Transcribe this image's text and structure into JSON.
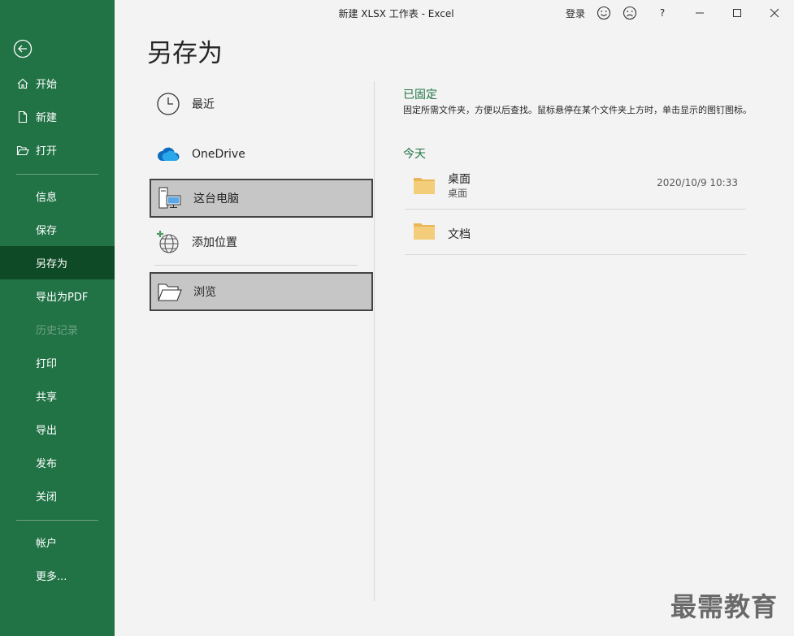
{
  "window": {
    "title": "新建 XLSX 工作表  -  Excel",
    "signin_label": "登录",
    "help_label": "?"
  },
  "sidebar": {
    "items": [
      {
        "label": "开始",
        "icon": "home-icon"
      },
      {
        "label": "新建",
        "icon": "new-document-icon"
      },
      {
        "label": "打开",
        "icon": "open-folder-icon"
      },
      {
        "label": "信息"
      },
      {
        "label": "保存"
      },
      {
        "label": "另存为",
        "active": true
      },
      {
        "label": "导出为PDF"
      },
      {
        "label": "历史记录",
        "disabled": true
      },
      {
        "label": "打印"
      },
      {
        "label": "共享"
      },
      {
        "label": "导出"
      },
      {
        "label": "发布"
      },
      {
        "label": "关闭"
      },
      {
        "label": "帐户"
      },
      {
        "label": "更多..."
      }
    ]
  },
  "page": {
    "title": "另存为"
  },
  "locations": [
    {
      "label": "最近",
      "icon": "clock-icon"
    },
    {
      "label": "OneDrive",
      "icon": "onedrive-cloud-icon"
    },
    {
      "label": "这台电脑",
      "icon": "computer-icon",
      "selected": true
    },
    {
      "label": "添加位置",
      "icon": "add-location-globe-icon"
    },
    {
      "label": "浏览",
      "icon": "browse-folder-icon",
      "selected": true
    }
  ],
  "pinned": {
    "heading": "已固定",
    "description": "固定所需文件夹，方便以后查找。鼠标悬停在某个文件夹上方时，单击显示的图钉图标。"
  },
  "today": {
    "heading": "今天",
    "folders": [
      {
        "name": "桌面",
        "path": "桌面",
        "date": "2020/10/9 10:33"
      },
      {
        "name": "文档"
      }
    ]
  },
  "watermark": "最需教育",
  "colors": {
    "accent": "#217346",
    "active": "#0e4a25",
    "folder": "#f0c86b"
  }
}
